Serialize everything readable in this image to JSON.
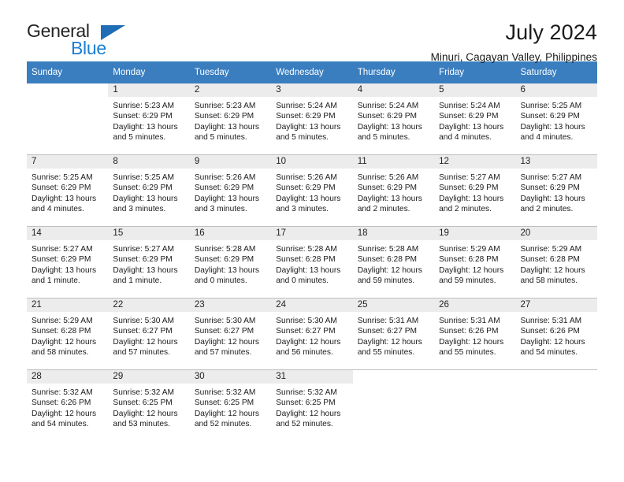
{
  "brand": {
    "name_part1": "General",
    "name_part2": "Blue",
    "accent_color": "#1b7fd4",
    "triangle_color": "#1f6db5"
  },
  "header": {
    "title": "July 2024",
    "subtitle": "Minuri, Cagayan Valley, Philippines"
  },
  "calendar": {
    "header_bg": "#3a7ebf",
    "daynum_bg": "#ececec",
    "weekdays": [
      "Sunday",
      "Monday",
      "Tuesday",
      "Wednesday",
      "Thursday",
      "Friday",
      "Saturday"
    ],
    "weeks": [
      [
        {
          "day": "",
          "sunrise": "",
          "sunset": "",
          "daylight1": "",
          "daylight2": ""
        },
        {
          "day": "1",
          "sunrise": "Sunrise: 5:23 AM",
          "sunset": "Sunset: 6:29 PM",
          "daylight1": "Daylight: 13 hours",
          "daylight2": "and 5 minutes."
        },
        {
          "day": "2",
          "sunrise": "Sunrise: 5:23 AM",
          "sunset": "Sunset: 6:29 PM",
          "daylight1": "Daylight: 13 hours",
          "daylight2": "and 5 minutes."
        },
        {
          "day": "3",
          "sunrise": "Sunrise: 5:24 AM",
          "sunset": "Sunset: 6:29 PM",
          "daylight1": "Daylight: 13 hours",
          "daylight2": "and 5 minutes."
        },
        {
          "day": "4",
          "sunrise": "Sunrise: 5:24 AM",
          "sunset": "Sunset: 6:29 PM",
          "daylight1": "Daylight: 13 hours",
          "daylight2": "and 5 minutes."
        },
        {
          "day": "5",
          "sunrise": "Sunrise: 5:24 AM",
          "sunset": "Sunset: 6:29 PM",
          "daylight1": "Daylight: 13 hours",
          "daylight2": "and 4 minutes."
        },
        {
          "day": "6",
          "sunrise": "Sunrise: 5:25 AM",
          "sunset": "Sunset: 6:29 PM",
          "daylight1": "Daylight: 13 hours",
          "daylight2": "and 4 minutes."
        }
      ],
      [
        {
          "day": "7",
          "sunrise": "Sunrise: 5:25 AM",
          "sunset": "Sunset: 6:29 PM",
          "daylight1": "Daylight: 13 hours",
          "daylight2": "and 4 minutes."
        },
        {
          "day": "8",
          "sunrise": "Sunrise: 5:25 AM",
          "sunset": "Sunset: 6:29 PM",
          "daylight1": "Daylight: 13 hours",
          "daylight2": "and 3 minutes."
        },
        {
          "day": "9",
          "sunrise": "Sunrise: 5:26 AM",
          "sunset": "Sunset: 6:29 PM",
          "daylight1": "Daylight: 13 hours",
          "daylight2": "and 3 minutes."
        },
        {
          "day": "10",
          "sunrise": "Sunrise: 5:26 AM",
          "sunset": "Sunset: 6:29 PM",
          "daylight1": "Daylight: 13 hours",
          "daylight2": "and 3 minutes."
        },
        {
          "day": "11",
          "sunrise": "Sunrise: 5:26 AM",
          "sunset": "Sunset: 6:29 PM",
          "daylight1": "Daylight: 13 hours",
          "daylight2": "and 2 minutes."
        },
        {
          "day": "12",
          "sunrise": "Sunrise: 5:27 AM",
          "sunset": "Sunset: 6:29 PM",
          "daylight1": "Daylight: 13 hours",
          "daylight2": "and 2 minutes."
        },
        {
          "day": "13",
          "sunrise": "Sunrise: 5:27 AM",
          "sunset": "Sunset: 6:29 PM",
          "daylight1": "Daylight: 13 hours",
          "daylight2": "and 2 minutes."
        }
      ],
      [
        {
          "day": "14",
          "sunrise": "Sunrise: 5:27 AM",
          "sunset": "Sunset: 6:29 PM",
          "daylight1": "Daylight: 13 hours",
          "daylight2": "and 1 minute."
        },
        {
          "day": "15",
          "sunrise": "Sunrise: 5:27 AM",
          "sunset": "Sunset: 6:29 PM",
          "daylight1": "Daylight: 13 hours",
          "daylight2": "and 1 minute."
        },
        {
          "day": "16",
          "sunrise": "Sunrise: 5:28 AM",
          "sunset": "Sunset: 6:29 PM",
          "daylight1": "Daylight: 13 hours",
          "daylight2": "and 0 minutes."
        },
        {
          "day": "17",
          "sunrise": "Sunrise: 5:28 AM",
          "sunset": "Sunset: 6:28 PM",
          "daylight1": "Daylight: 13 hours",
          "daylight2": "and 0 minutes."
        },
        {
          "day": "18",
          "sunrise": "Sunrise: 5:28 AM",
          "sunset": "Sunset: 6:28 PM",
          "daylight1": "Daylight: 12 hours",
          "daylight2": "and 59 minutes."
        },
        {
          "day": "19",
          "sunrise": "Sunrise: 5:29 AM",
          "sunset": "Sunset: 6:28 PM",
          "daylight1": "Daylight: 12 hours",
          "daylight2": "and 59 minutes."
        },
        {
          "day": "20",
          "sunrise": "Sunrise: 5:29 AM",
          "sunset": "Sunset: 6:28 PM",
          "daylight1": "Daylight: 12 hours",
          "daylight2": "and 58 minutes."
        }
      ],
      [
        {
          "day": "21",
          "sunrise": "Sunrise: 5:29 AM",
          "sunset": "Sunset: 6:28 PM",
          "daylight1": "Daylight: 12 hours",
          "daylight2": "and 58 minutes."
        },
        {
          "day": "22",
          "sunrise": "Sunrise: 5:30 AM",
          "sunset": "Sunset: 6:27 PM",
          "daylight1": "Daylight: 12 hours",
          "daylight2": "and 57 minutes."
        },
        {
          "day": "23",
          "sunrise": "Sunrise: 5:30 AM",
          "sunset": "Sunset: 6:27 PM",
          "daylight1": "Daylight: 12 hours",
          "daylight2": "and 57 minutes."
        },
        {
          "day": "24",
          "sunrise": "Sunrise: 5:30 AM",
          "sunset": "Sunset: 6:27 PM",
          "daylight1": "Daylight: 12 hours",
          "daylight2": "and 56 minutes."
        },
        {
          "day": "25",
          "sunrise": "Sunrise: 5:31 AM",
          "sunset": "Sunset: 6:27 PM",
          "daylight1": "Daylight: 12 hours",
          "daylight2": "and 55 minutes."
        },
        {
          "day": "26",
          "sunrise": "Sunrise: 5:31 AM",
          "sunset": "Sunset: 6:26 PM",
          "daylight1": "Daylight: 12 hours",
          "daylight2": "and 55 minutes."
        },
        {
          "day": "27",
          "sunrise": "Sunrise: 5:31 AM",
          "sunset": "Sunset: 6:26 PM",
          "daylight1": "Daylight: 12 hours",
          "daylight2": "and 54 minutes."
        }
      ],
      [
        {
          "day": "28",
          "sunrise": "Sunrise: 5:32 AM",
          "sunset": "Sunset: 6:26 PM",
          "daylight1": "Daylight: 12 hours",
          "daylight2": "and 54 minutes."
        },
        {
          "day": "29",
          "sunrise": "Sunrise: 5:32 AM",
          "sunset": "Sunset: 6:25 PM",
          "daylight1": "Daylight: 12 hours",
          "daylight2": "and 53 minutes."
        },
        {
          "day": "30",
          "sunrise": "Sunrise: 5:32 AM",
          "sunset": "Sunset: 6:25 PM",
          "daylight1": "Daylight: 12 hours",
          "daylight2": "and 52 minutes."
        },
        {
          "day": "31",
          "sunrise": "Sunrise: 5:32 AM",
          "sunset": "Sunset: 6:25 PM",
          "daylight1": "Daylight: 12 hours",
          "daylight2": "and 52 minutes."
        },
        {
          "day": "",
          "sunrise": "",
          "sunset": "",
          "daylight1": "",
          "daylight2": ""
        },
        {
          "day": "",
          "sunrise": "",
          "sunset": "",
          "daylight1": "",
          "daylight2": ""
        },
        {
          "day": "",
          "sunrise": "",
          "sunset": "",
          "daylight1": "",
          "daylight2": ""
        }
      ]
    ]
  }
}
